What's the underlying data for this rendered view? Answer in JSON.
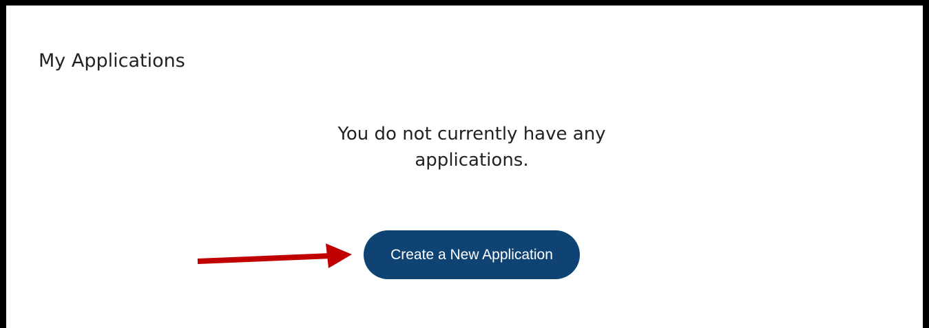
{
  "page": {
    "title": "My Applications"
  },
  "main": {
    "empty_message": "You do not currently have any applications.",
    "create_button_label": "Create a New Application"
  },
  "annotation": {
    "arrow_icon": "arrow-right-icon",
    "arrow_color": "#c00000"
  },
  "colors": {
    "button_background": "#0f4373",
    "button_text": "#ffffff",
    "frame_border": "#000000"
  }
}
